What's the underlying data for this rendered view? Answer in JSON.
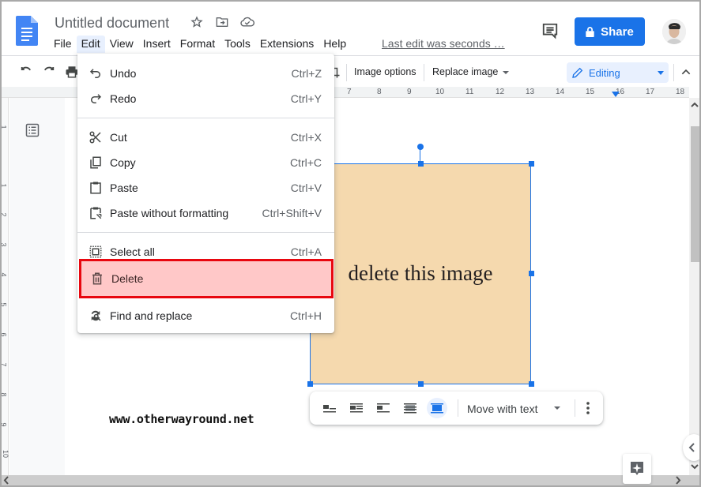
{
  "app": {
    "title": "Untitled document",
    "last_edit": "Last edit was seconds …",
    "share_label": "Share",
    "brand_color": "#1a73e8"
  },
  "menubar": [
    "File",
    "Edit",
    "View",
    "Insert",
    "Format",
    "Tools",
    "Extensions",
    "Help"
  ],
  "toolbar": {
    "image_options": "Image options",
    "replace_image": "Replace image",
    "mode": "Editing"
  },
  "ruler": {
    "horizontal": [
      "7",
      "8",
      "9",
      "10",
      "11",
      "12",
      "13",
      "14",
      "15",
      "16",
      "17",
      "18"
    ],
    "vertical": [
      "1",
      "1",
      "2",
      "3",
      "4",
      "5",
      "6",
      "7",
      "8",
      "9",
      "10"
    ]
  },
  "edit_menu": {
    "items": [
      {
        "label": "Undo",
        "shortcut": "Ctrl+Z",
        "icon": "undo-icon"
      },
      {
        "label": "Redo",
        "shortcut": "Ctrl+Y",
        "icon": "redo-icon"
      },
      {
        "label": "Cut",
        "shortcut": "Ctrl+X",
        "icon": "scissors-icon"
      },
      {
        "label": "Copy",
        "shortcut": "Ctrl+C",
        "icon": "copy-icon"
      },
      {
        "label": "Paste",
        "shortcut": "Ctrl+V",
        "icon": "paste-icon"
      },
      {
        "label": "Paste without formatting",
        "shortcut": "Ctrl+Shift+V",
        "icon": "paste-plain-icon"
      },
      {
        "label": "Select all",
        "shortcut": "Ctrl+A",
        "icon": "select-all-icon"
      },
      {
        "label": "Delete",
        "shortcut": "",
        "icon": "trash-icon",
        "highlighted": true
      },
      {
        "label": "Find and replace",
        "shortcut": "Ctrl+H",
        "icon": "find-replace-icon"
      }
    ]
  },
  "document": {
    "image_text": "delete this image",
    "image_color": "#f5d9ae",
    "watermark": "www.otherwayround.net"
  },
  "image_toolbar": {
    "wrap_options": [
      "In line",
      "Wrap text",
      "Break text",
      "Behind text",
      "In front of text"
    ],
    "active_wrap": "In front of text",
    "position_mode": "Move with text"
  },
  "highlight_color": "#e8070f"
}
